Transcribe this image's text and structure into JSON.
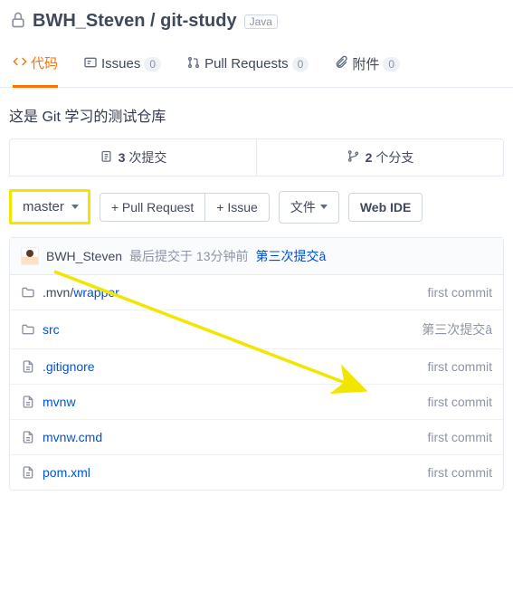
{
  "header": {
    "owner": "BWH_Steven",
    "sep": " / ",
    "repo": "git-study",
    "lang": "Java"
  },
  "tabs": {
    "code": "代码",
    "issues": "Issues",
    "issues_count": "0",
    "pr": "Pull Requests",
    "pr_count": "0",
    "attach": "附件",
    "attach_count": "0"
  },
  "description": "这是 Git 学习的测试仓库",
  "stats": {
    "commits_num": "3",
    "commits_label": " 次提交",
    "branches_num": "2",
    "branches_label": " 个分支"
  },
  "actions": {
    "branch": "master",
    "pull_request": "+ Pull Request",
    "issue": "+ Issue",
    "files": "文件",
    "webide": "Web IDE"
  },
  "latest_commit": {
    "user": "BWH_Steven",
    "meta": "最后提交于 13分钟前 ",
    "msg": "第三次提交â"
  },
  "files": [
    {
      "type": "dir",
      "prefix": ".mvn/",
      "name": "wrapper",
      "msg": "first commit"
    },
    {
      "type": "dir",
      "prefix": "",
      "name": "src",
      "msg": "第三次提交â"
    },
    {
      "type": "file",
      "prefix": "",
      "name": ".gitignore",
      "msg": "first commit"
    },
    {
      "type": "file",
      "prefix": "",
      "name": "mvnw",
      "msg": "first commit"
    },
    {
      "type": "file",
      "prefix": "",
      "name": "mvnw.cmd",
      "msg": "first commit"
    },
    {
      "type": "file",
      "prefix": "",
      "name": "pom.xml",
      "msg": "first commit"
    }
  ]
}
